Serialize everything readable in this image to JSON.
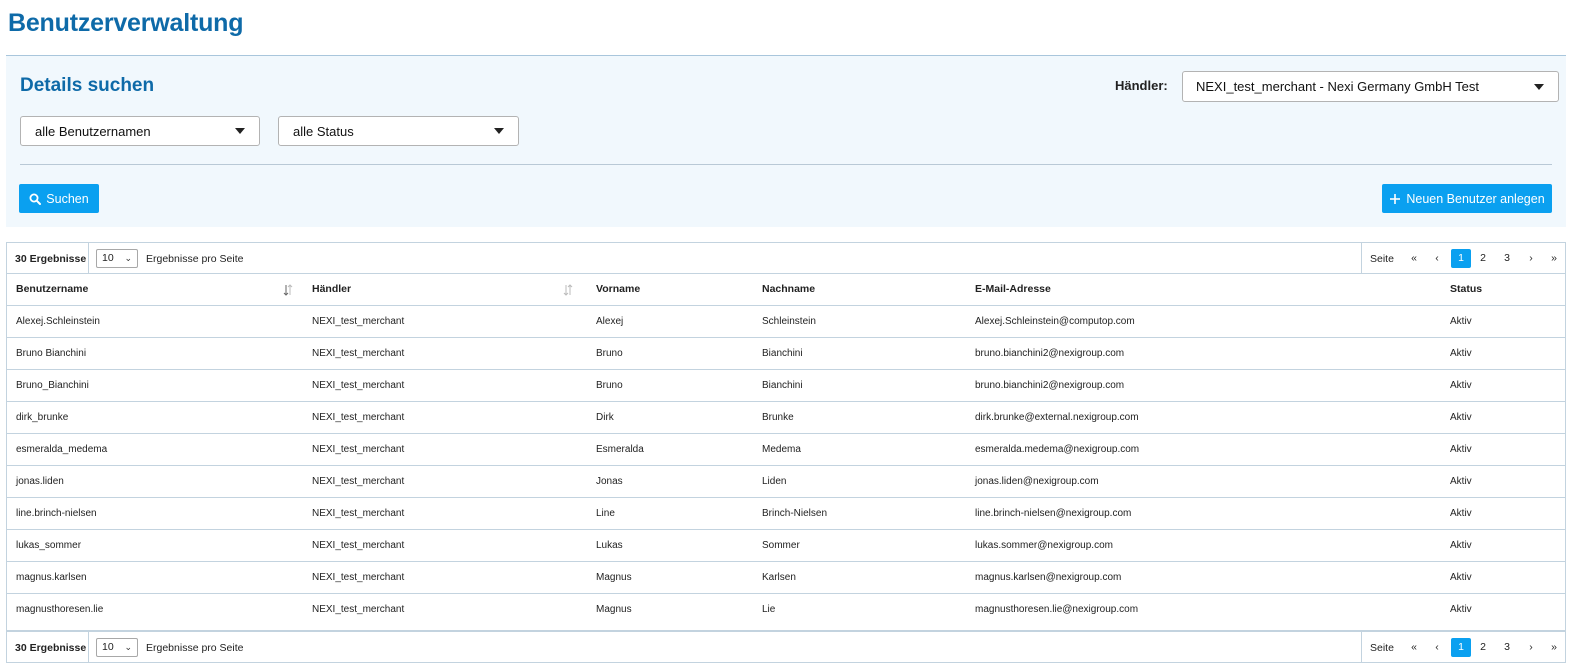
{
  "page": {
    "title": "Benutzerverwaltung"
  },
  "search": {
    "title": "Details suchen",
    "merchant_label": "Händler:",
    "merchant_value": "NEXI_test_merchant - Nexi Germany GmbH Test",
    "users_value": "alle Benutzernamen",
    "status_value": "alle Status",
    "search_button": "Suchen",
    "add_button": "Neuen Benutzer anlegen"
  },
  "pager": {
    "results": "30 Ergebnisse",
    "page_size": "10",
    "per_page_label": "Ergebnisse pro Seite",
    "page_label": "Seite",
    "first": "«",
    "prev": "‹",
    "pages": [
      "1",
      "2",
      "3"
    ],
    "active_page": "1",
    "next": "›",
    "last": "»"
  },
  "table": {
    "columns": [
      "Benutzername",
      "Händler",
      "Vorname",
      "Nachname",
      "E-Mail-Adresse",
      "Status"
    ],
    "rows": [
      [
        "Alexej.Schleinstein",
        "NEXI_test_merchant",
        "Alexej",
        "Schleinstein",
        "Alexej.Schleinstein@computop.com",
        "Aktiv"
      ],
      [
        "Bruno Bianchini",
        "NEXI_test_merchant",
        "Bruno",
        "Bianchini",
        "bruno.bianchini2@nexigroup.com",
        "Aktiv"
      ],
      [
        "Bruno_Bianchini",
        "NEXI_test_merchant",
        "Bruno",
        "Bianchini",
        "bruno.bianchini2@nexigroup.com",
        "Aktiv"
      ],
      [
        "dirk_brunke",
        "NEXI_test_merchant",
        "Dirk",
        "Brunke",
        "dirk.brunke@external.nexigroup.com",
        "Aktiv"
      ],
      [
        "esmeralda_medema",
        "NEXI_test_merchant",
        "Esmeralda",
        "Medema",
        "esmeralda.medema@nexigroup.com",
        "Aktiv"
      ],
      [
        "jonas.liden",
        "NEXI_test_merchant",
        "Jonas",
        "Liden",
        "jonas.liden@nexigroup.com",
        "Aktiv"
      ],
      [
        "line.brinch-nielsen",
        "NEXI_test_merchant",
        "Line",
        "Brinch-Nielsen",
        "line.brinch-nielsen@nexigroup.com",
        "Aktiv"
      ],
      [
        "lukas_sommer",
        "NEXI_test_merchant",
        "Lukas",
        "Sommer",
        "lukas.sommer@nexigroup.com",
        "Aktiv"
      ],
      [
        "magnus.karlsen",
        "NEXI_test_merchant",
        "Magnus",
        "Karlsen",
        "magnus.karlsen@nexigroup.com",
        "Aktiv"
      ],
      [
        "magnusthoresen.lie",
        "NEXI_test_merchant",
        "Magnus",
        "Lie",
        "magnusthoresen.lie@nexigroup.com",
        "Aktiv"
      ]
    ]
  }
}
